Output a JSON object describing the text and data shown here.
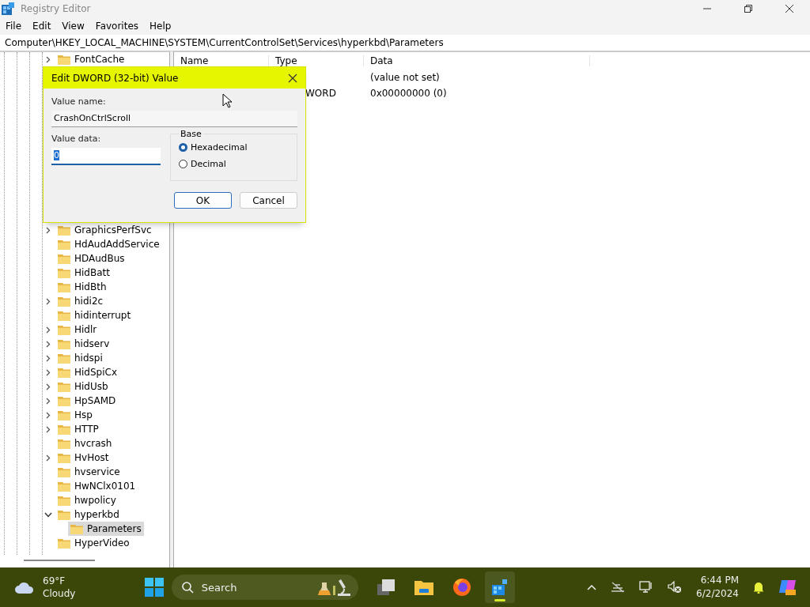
{
  "window": {
    "title": "Registry Editor"
  },
  "menu": [
    "File",
    "Edit",
    "View",
    "Favorites",
    "Help"
  ],
  "address": "Computer\\HKEY_LOCAL_MACHINE\\SYSTEM\\CurrentControlSet\\Services\\hyperkbd\\Parameters",
  "tree_top": [
    {
      "label": "FontCache",
      "expandable": true,
      "expanded": false,
      "selected": false
    }
  ],
  "tree": [
    {
      "label": "GraphicsPerfSvc",
      "expandable": true,
      "expanded": false,
      "selected": false
    },
    {
      "label": "HdAudAddService",
      "expandable": false,
      "selected": false
    },
    {
      "label": "HDAudBus",
      "expandable": false,
      "selected": false
    },
    {
      "label": "HidBatt",
      "expandable": false,
      "selected": false
    },
    {
      "label": "HidBth",
      "expandable": false,
      "selected": false
    },
    {
      "label": "hidi2c",
      "expandable": true,
      "expanded": false,
      "selected": false
    },
    {
      "label": "hidinterrupt",
      "expandable": false,
      "selected": false
    },
    {
      "label": "Hidlr",
      "expandable": true,
      "expanded": false,
      "selected": false
    },
    {
      "label": "hidserv",
      "expandable": true,
      "expanded": false,
      "selected": false
    },
    {
      "label": "hidspi",
      "expandable": true,
      "expanded": false,
      "selected": false
    },
    {
      "label": "HidSpiCx",
      "expandable": true,
      "expanded": false,
      "selected": false
    },
    {
      "label": "HidUsb",
      "expandable": true,
      "expanded": false,
      "selected": false
    },
    {
      "label": "HpSAMD",
      "expandable": true,
      "expanded": false,
      "selected": false
    },
    {
      "label": "Hsp",
      "expandable": true,
      "expanded": false,
      "selected": false
    },
    {
      "label": "HTTP",
      "expandable": true,
      "expanded": false,
      "selected": false
    },
    {
      "label": "hvcrash",
      "expandable": false,
      "selected": false
    },
    {
      "label": "HvHost",
      "expandable": true,
      "expanded": false,
      "selected": false
    },
    {
      "label": "hvservice",
      "expandable": false,
      "selected": false
    },
    {
      "label": "HwNClx0101",
      "expandable": false,
      "selected": false
    },
    {
      "label": "hwpolicy",
      "expandable": false,
      "selected": false
    },
    {
      "label": "hyperkbd",
      "expandable": true,
      "expanded": true,
      "selected": false,
      "children": [
        {
          "label": "Parameters",
          "expandable": false,
          "selected": true
        }
      ]
    },
    {
      "label": "HyperVideo",
      "expandable": false,
      "selected": false
    }
  ],
  "columns": [
    "Name",
    "Type",
    "Data"
  ],
  "values": [
    {
      "data": "(value not set)"
    },
    {
      "type": "WORD",
      "data": "0x00000000 (0)"
    }
  ],
  "dialog": {
    "title": "Edit DWORD (32-bit) Value",
    "value_name_label": "Value name:",
    "value_name": "CrashOnCtrlScroll",
    "value_data_label": "Value data:",
    "value_data": "0",
    "base_label": "Base",
    "bases": [
      {
        "label": "Hexadecimal",
        "selected": true
      },
      {
        "label": "Decimal",
        "selected": false
      }
    ],
    "buttons": [
      {
        "label": "OK",
        "default": true
      },
      {
        "label": "Cancel",
        "default": false
      }
    ]
  },
  "taskbar": {
    "temperature": "69°F",
    "condition": "Cloudy",
    "search": "Search",
    "time": "6:44 PM",
    "date": "6/2/2024",
    "apps": [
      {
        "kind": "taskview",
        "selected": false
      },
      {
        "kind": "explorer",
        "selected": false
      },
      {
        "kind": "firefox",
        "selected": false
      },
      {
        "kind": "regedit",
        "selected": true
      }
    ]
  }
}
